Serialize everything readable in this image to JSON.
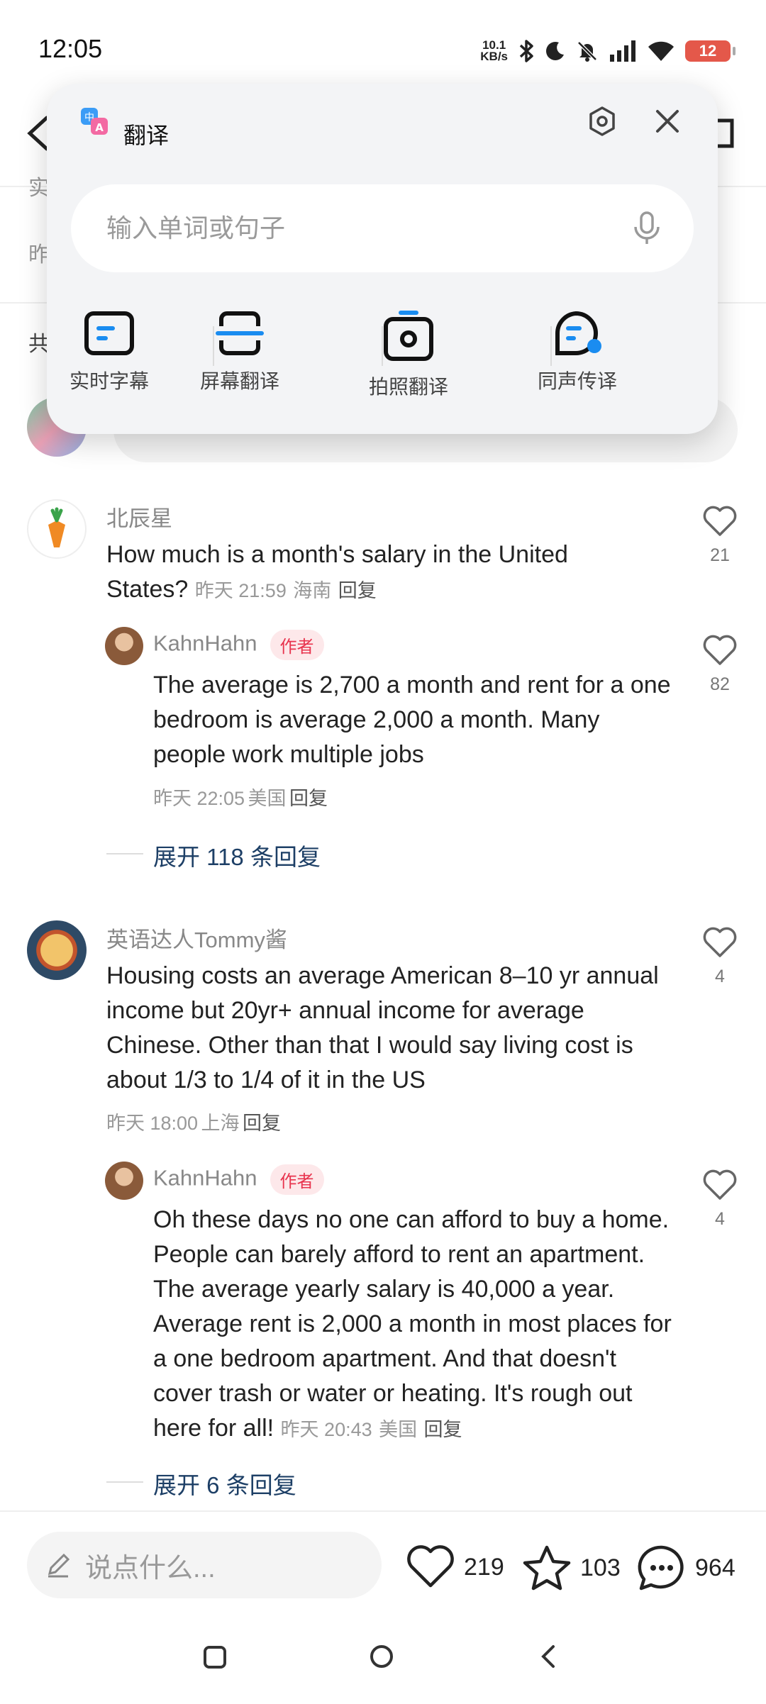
{
  "status_bar": {
    "time": "12:05",
    "net_speed_value": "10.1",
    "net_speed_unit": "KB/s",
    "battery": "12",
    "icons": [
      "bluetooth-icon",
      "moon-icon",
      "mute-bell-icon",
      "signal-icon",
      "wifi-icon",
      "battery-icon"
    ]
  },
  "background": {
    "frag_1": "实",
    "frag_2": "昨",
    "frag_3": "共"
  },
  "translate_popup": {
    "title": "翻译",
    "input_placeholder": "输入单词或句子",
    "tools": [
      {
        "label": "实时字幕",
        "icon": "live-subtitle-icon"
      },
      {
        "label": "屏幕翻译",
        "icon": "screen-translate-icon"
      },
      {
        "label": "拍照翻译",
        "icon": "camera-translate-icon"
      },
      {
        "label": "同声传译",
        "icon": "simultaneous-interpret-icon"
      }
    ],
    "accent": "#1a8cf0"
  },
  "comments": [
    {
      "user": "北辰星",
      "text": "How much is a month's salary in the United States?",
      "time": "昨天 21:59",
      "location": "海南",
      "reply_label": "回复",
      "likes": "21",
      "replies": [
        {
          "user": "KahnHahn",
          "badge": "作者",
          "text": "The average is 2,700 a month and rent for a one bedroom is average 2,000 a month. Many people work multiple jobs",
          "time": "昨天 22:05",
          "location": "美国",
          "reply_label": "回复",
          "likes": "82"
        }
      ],
      "expand_label": "展开 118 条回复"
    },
    {
      "user": "英语达人Tommy酱",
      "text": "Housing costs an average American 8–10 yr annual income but 20yr+ annual income for average Chinese. Other than that I would say living cost is about 1/3 to 1/4 of it in the US",
      "time": "昨天 18:00",
      "location": "上海",
      "reply_label": "回复",
      "likes": "4",
      "replies": [
        {
          "user": "KahnHahn",
          "badge": "作者",
          "text": "Oh these days no one can afford to buy a home. People can barely afford to rent an apartment. The average yearly salary is 40,000 a year. Average rent is 2,000 a month in most places for a one bedroom apartment. And that doesn't cover trash or water or heating. It's rough out here for all!",
          "time": "昨天 20:43",
          "location": "美国",
          "reply_label": "回复",
          "likes": "4"
        }
      ],
      "expand_label": "展开 6 条回复"
    }
  ],
  "bottom_bar": {
    "comment_placeholder": "说点什么...",
    "likes": "219",
    "favorites": "103",
    "comments": "964"
  }
}
